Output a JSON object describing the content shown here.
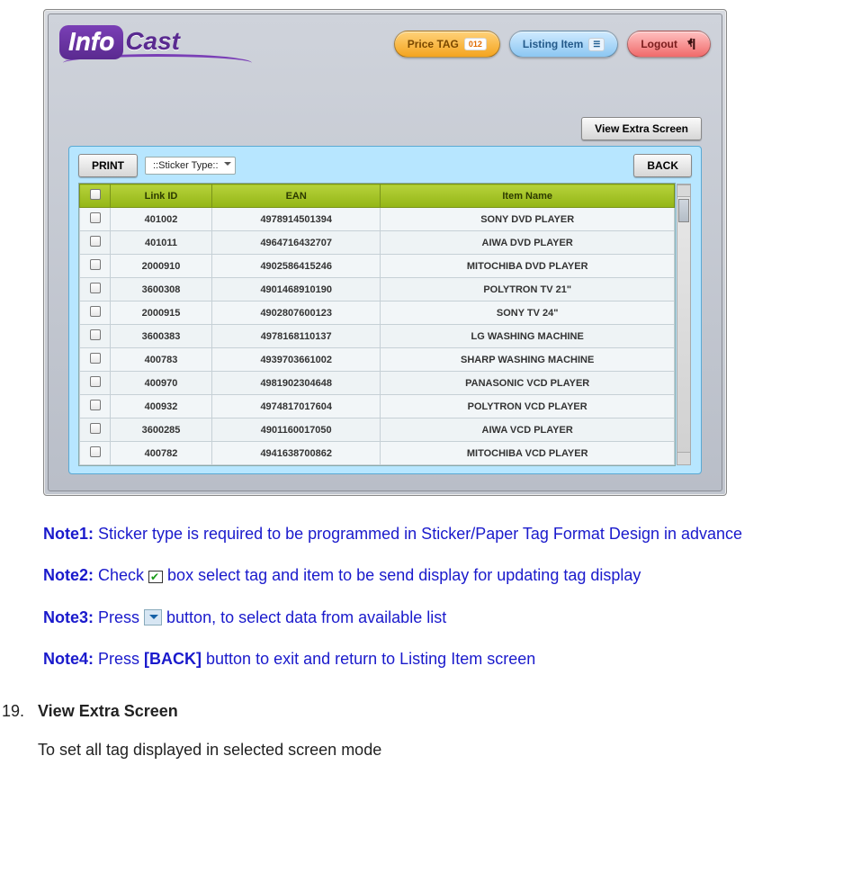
{
  "logo": {
    "part1": "Info",
    "part2": "Cast"
  },
  "pills": {
    "price_tag": "Price TAG",
    "price_tag_badge": "012",
    "listing": "Listing Item",
    "logout": "Logout"
  },
  "buttons": {
    "view_extra": "View Extra Screen",
    "print": "PRINT",
    "back": "BACK"
  },
  "sticker_type": {
    "placeholder": "::Sticker Type::"
  },
  "columns": {
    "chk": "",
    "link_id": "Link ID",
    "ean": "EAN",
    "item_name": "Item Name"
  },
  "rows": [
    {
      "link_id": "401002",
      "ean": "4978914501394",
      "item_name": "SONY DVD PLAYER"
    },
    {
      "link_id": "401011",
      "ean": "4964716432707",
      "item_name": "AIWA DVD PLAYER"
    },
    {
      "link_id": "2000910",
      "ean": "4902586415246",
      "item_name": "MITOCHIBA DVD PLAYER"
    },
    {
      "link_id": "3600308",
      "ean": "4901468910190",
      "item_name": "POLYTRON TV 21\""
    },
    {
      "link_id": "2000915",
      "ean": "4902807600123",
      "item_name": "SONY TV 24\""
    },
    {
      "link_id": "3600383",
      "ean": "4978168110137",
      "item_name": "LG WASHING MACHINE"
    },
    {
      "link_id": "400783",
      "ean": "4939703661002",
      "item_name": "SHARP WASHING MACHINE"
    },
    {
      "link_id": "400970",
      "ean": "4981902304648",
      "item_name": "PANASONIC VCD PLAYER"
    },
    {
      "link_id": "400932",
      "ean": "4974817017604",
      "item_name": "POLYTRON VCD PLAYER"
    },
    {
      "link_id": "3600285",
      "ean": "4901160017050",
      "item_name": "AIWA VCD PLAYER"
    },
    {
      "link_id": "400782",
      "ean": "4941638700862",
      "item_name": "MITOCHIBA VCD PLAYER"
    }
  ],
  "notes": {
    "n1_label": "Note1:",
    "n1_text": " Sticker type is required to be programmed in Sticker/Paper Tag Format Design in advance",
    "n2_label": "Note2:",
    "n2_before": " Check ",
    "n2_after": " box select tag and item to be send display for updating tag display",
    "n3_label": "Note3:",
    "n3_before": " Press ",
    "n3_after": " button, to select data from available list",
    "n4_label": "Note4:",
    "n4_before": " Press ",
    "n4_back": "[BACK]",
    "n4_after": " button to exit and return to Listing Item screen"
  },
  "section": {
    "number": "19.",
    "title": "View Extra Screen",
    "body": "To set all tag displayed in selected screen mode"
  }
}
